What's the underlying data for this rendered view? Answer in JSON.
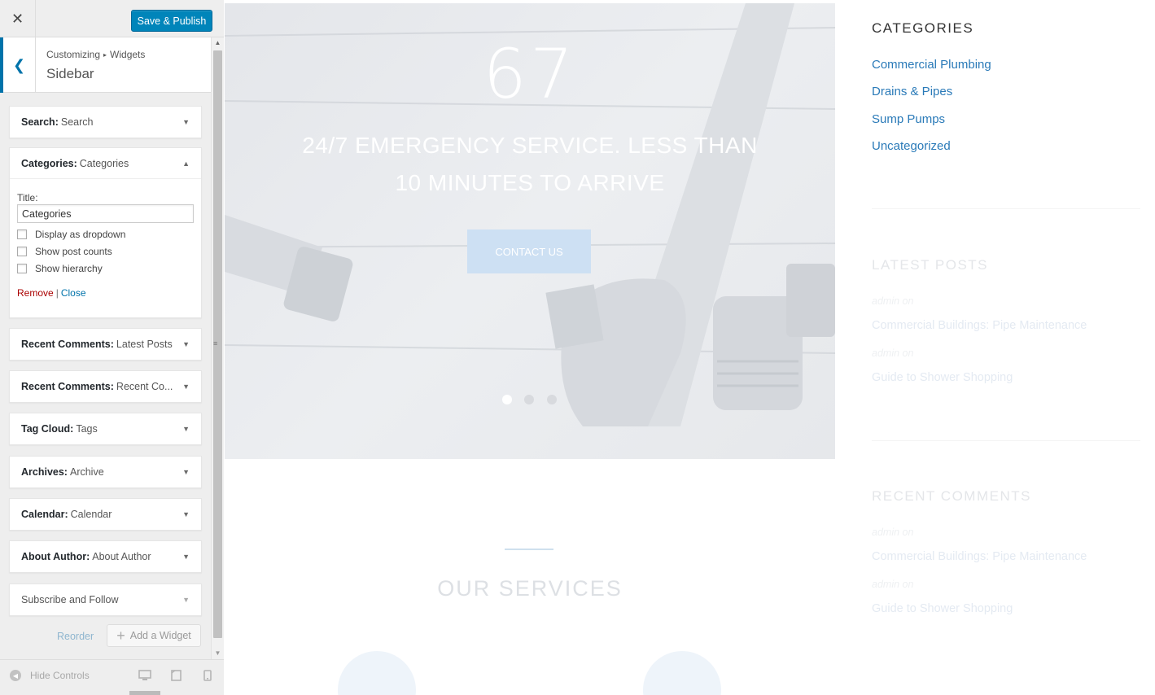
{
  "customizer": {
    "close_icon": "close-icon",
    "publish_label": "Save & Publish",
    "breadcrumb": [
      "Customizing",
      "Widgets"
    ],
    "breadcrumb_sep": "▸",
    "section_title": "Sidebar",
    "widgets": [
      {
        "type": "Search:",
        "title": "Search"
      },
      {
        "type": "Categories:",
        "title": "Categories"
      },
      {
        "type": "Recent Comments:",
        "title": "Latest Posts"
      },
      {
        "type": "Recent Comments:",
        "title": "Recent Co..."
      },
      {
        "type": "Tag Cloud:",
        "title": "Tags"
      },
      {
        "type": "Archives:",
        "title": "Archive"
      },
      {
        "type": "Calendar:",
        "title": "Calendar"
      },
      {
        "type": "About Author:",
        "title": "About Author"
      },
      {
        "type": "",
        "title": "Subscribe and Follow"
      }
    ],
    "expanded_widget": {
      "title_label": "Title:",
      "title_value": "Categories",
      "options": [
        "Display as dropdown",
        "Show post counts",
        "Show hierarchy"
      ],
      "remove_label": "Remove",
      "separator": "|",
      "close_label": "Close"
    },
    "reorder_label": "Reorder",
    "add_widget_label": "Add a Widget",
    "hide_controls_label": "Hide Controls"
  },
  "preview": {
    "hero": {
      "number": "67",
      "headline": "24/7 EMERGENCY SERVICE. LESS THAN 10 MINUTES TO ARRIVE",
      "button_label": "CONTACT US",
      "slide_count": 3,
      "active_slide": 1
    },
    "services_title": "OUR SERVICES",
    "sidebar": {
      "categories_title": "CATEGORIES",
      "categories": [
        "Commercial Plumbing",
        "Drains & Pipes",
        "Sump Pumps",
        "Uncategorized"
      ],
      "latest_posts_title": "LATEST POSTS",
      "latest_posts": [
        {
          "meta": "admin  on",
          "title": "Commercial Buildings: Pipe Maintenance"
        },
        {
          "meta": "admin  on",
          "title": "Guide to Shower Shopping"
        }
      ],
      "recent_comments_title": "RECENT COMMENTS",
      "recent_comments": [
        {
          "meta": "admin  on",
          "title": "Commercial Buildings: Pipe Maintenance"
        },
        {
          "meta": "admin  on",
          "title": "Guide to Shower Shopping"
        }
      ]
    }
  },
  "colors": {
    "accent": "#0073aa",
    "publish": "#0085ba",
    "link": "#2a7ab8",
    "remove": "#aa0000"
  }
}
